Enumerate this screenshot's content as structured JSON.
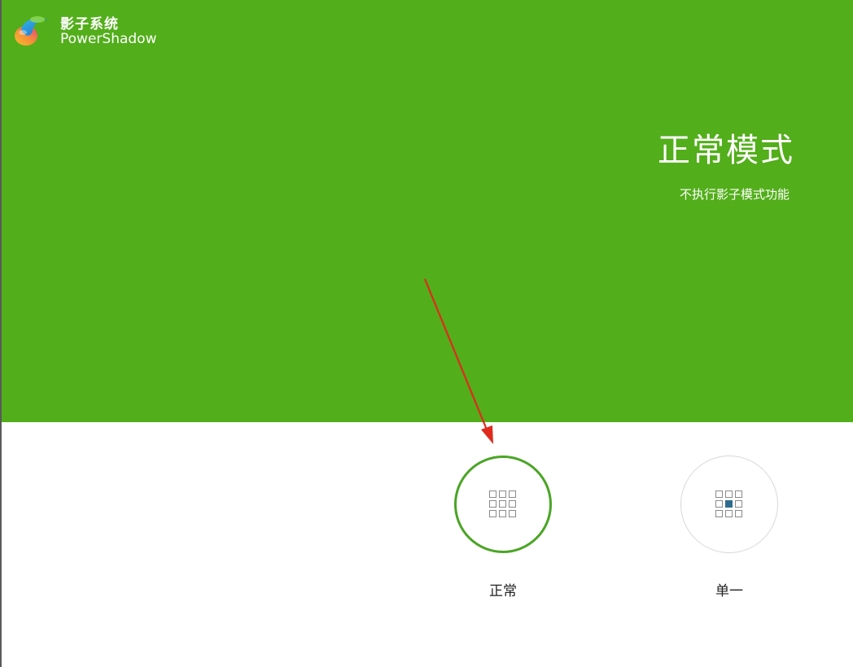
{
  "app": {
    "name_cn": "影子系统",
    "name_en": "PowerShadow"
  },
  "current_mode": {
    "title": "正常模式",
    "description": "不执行影子模式功能"
  },
  "modes": [
    {
      "label": "正常",
      "icon": "grid-icon",
      "selected": true
    },
    {
      "label": "单一",
      "icon": "grid-center-icon",
      "selected": false
    }
  ],
  "colors": {
    "header_green": "#52ae1a",
    "selected_ring": "#4aa524",
    "icon_gray": "#8a8a8a",
    "icon_highlight": "#2d6b8f",
    "annotation_arrow": "#e02a1e"
  }
}
